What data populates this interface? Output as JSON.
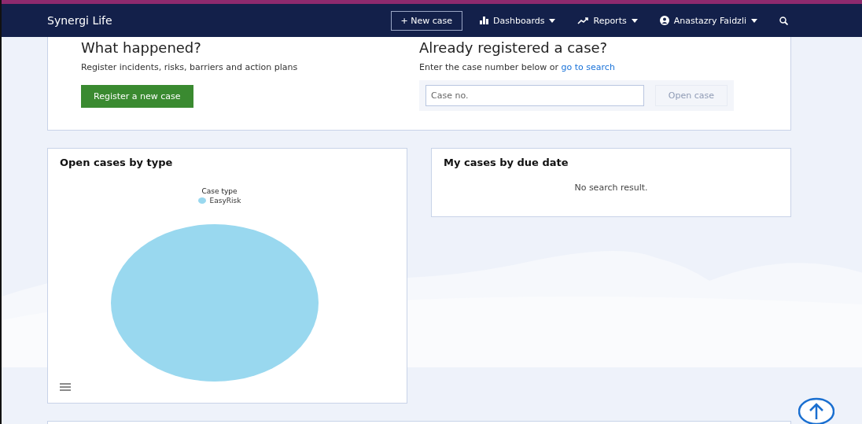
{
  "navbar": {
    "brand": "Synergi Life",
    "new_case": "+ New case",
    "menus": [
      {
        "kind": "dashboards",
        "label": "Dashboards"
      },
      {
        "kind": "reports",
        "label": "Reports"
      },
      {
        "kind": "user",
        "label": "Anastazry Faidzli"
      }
    ]
  },
  "register": {
    "title": "What happened?",
    "text": "Register incidents, risks, barriers and action plans",
    "button": "Register a new case"
  },
  "lookup": {
    "title": "Already registered a case?",
    "text": "Enter the case number below or ",
    "link": "go to search",
    "placeholder": "Case no.",
    "button": "Open case",
    "button_disabled": true
  },
  "type_chart": {
    "title": "Open cases by type",
    "legend_title": "Case type",
    "legend": [
      {
        "label": "EasyRisk",
        "color": "#99d8ef"
      }
    ]
  },
  "due_panel": {
    "title": "My cases by due date",
    "message": "No search result."
  }
}
